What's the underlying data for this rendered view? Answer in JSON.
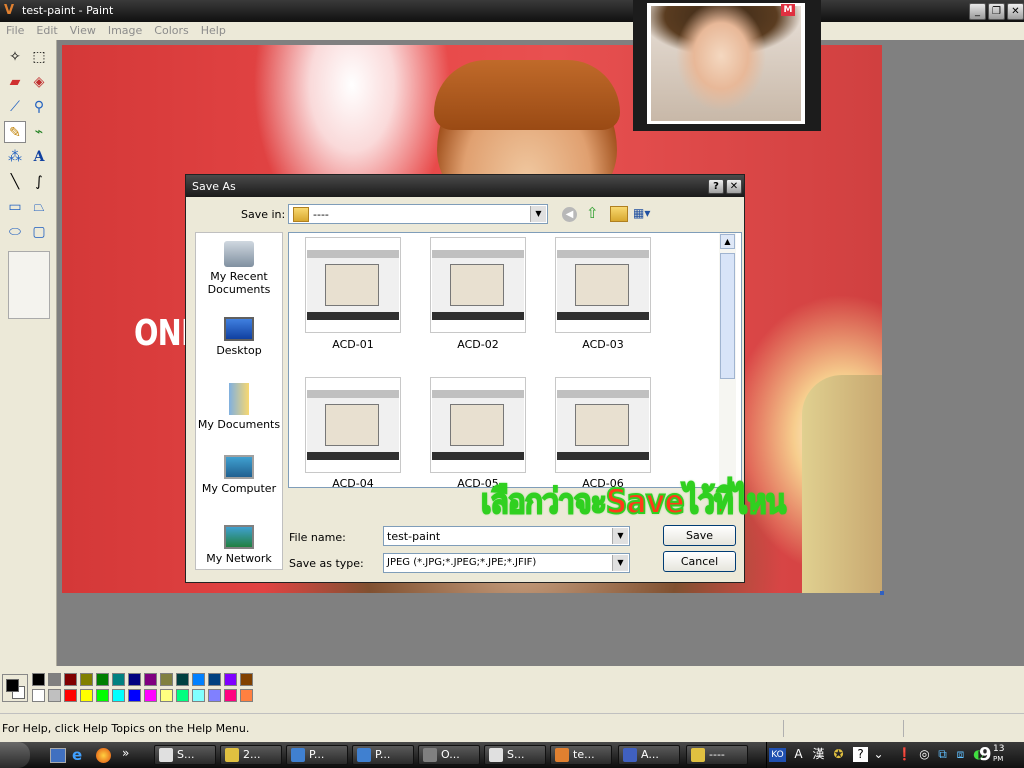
{
  "window": {
    "title": "test-paint - Paint"
  },
  "menu": [
    "File",
    "Edit",
    "View",
    "Image",
    "Colors",
    "Help"
  ],
  "canvas_image": {
    "logo_text": "ONI"
  },
  "dialog": {
    "title": "Save As",
    "save_in_label": "Save in:",
    "save_in_value": "----",
    "places": [
      "My Recent Documents",
      "Desktop",
      "My Documents",
      "My Computer",
      "My Network"
    ],
    "files": [
      "ACD-01",
      "ACD-02",
      "ACD-03",
      "ACD-04",
      "ACD-05",
      "ACD-06"
    ],
    "file_name_label": "File name:",
    "file_name_value": "test-paint",
    "save_type_label": "Save as type:",
    "save_type_value": "JPEG (*.JPG;*.JPEG;*.JPE;*.JFIF)",
    "save_button": "Save",
    "cancel_button": "Cancel"
  },
  "overlay_caption": "เลือกว่าจะSaveไว้ที่ไหน",
  "palette": {
    "primary": "#000000",
    "secondary": "#ffffff",
    "row1": [
      "#000000",
      "#808080",
      "#800000",
      "#808000",
      "#008000",
      "#008080",
      "#000080",
      "#800080",
      "#808040",
      "#004040",
      "#0080ff",
      "#004080",
      "#8000ff",
      "#804000"
    ],
    "row2": [
      "#ffffff",
      "#c0c0c0",
      "#ff0000",
      "#ffff00",
      "#00ff00",
      "#00ffff",
      "#0000ff",
      "#ff00ff",
      "#ffff80",
      "#00ff80",
      "#80ffff",
      "#8080ff",
      "#ff0080",
      "#ff8040"
    ]
  },
  "status": {
    "help_text": "For Help, click Help Topics on the Help Menu."
  },
  "taskbar": {
    "tasks": [
      "S...",
      "2...",
      "P...",
      "P...",
      "O...",
      "S...",
      "te...",
      "A...",
      "----"
    ],
    "tray_lang": "KO",
    "clock_hour": "9",
    "clock_min": "13",
    "clock_ampm": "PM"
  }
}
